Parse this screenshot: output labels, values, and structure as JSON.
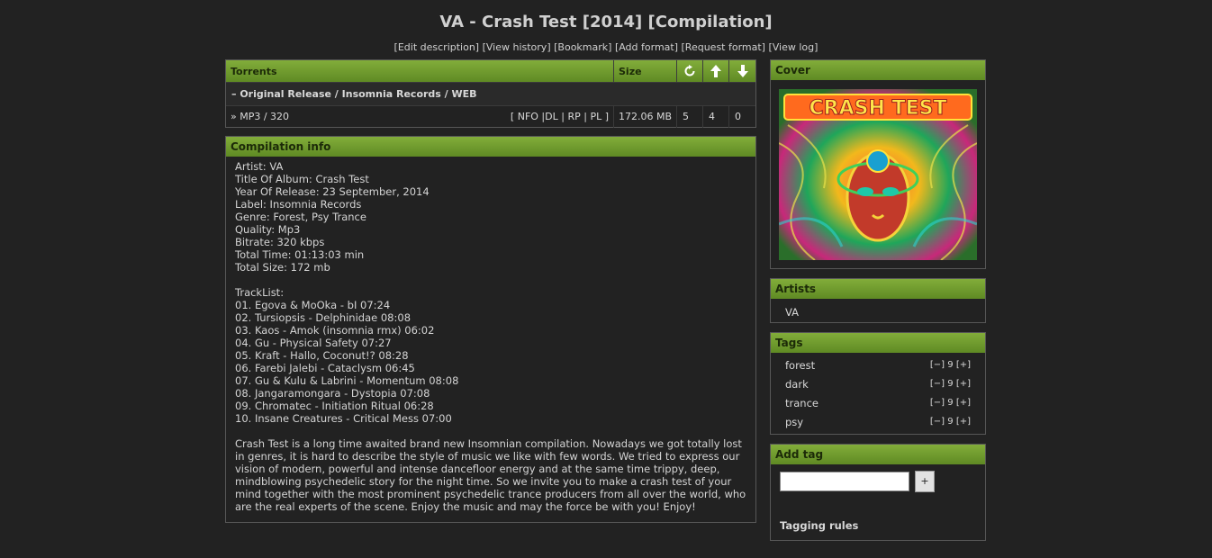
{
  "page": {
    "title": "VA - Crash Test [2014] [Compilation]"
  },
  "linkbox": {
    "edit_description": "[Edit description]",
    "view_history": "[View history]",
    "bookmark": "[Bookmark]",
    "add_format": "[Add format]",
    "request_format": "[Request format]",
    "view_log": "[View log]"
  },
  "torrents": {
    "header_torrents": "Torrents",
    "header_size": "Size",
    "snatches_icon": "refresh-icon",
    "seeders_icon": "arrow-up-icon",
    "leechers_icon": "arrow-down-icon",
    "group_label": "– Original Release / Insomnia Records / WEB",
    "format": {
      "name": "» MP3 / 320",
      "actions_open": "[",
      "nfo": "NFO",
      "dl": "DL",
      "rp": "RP",
      "pl": "PL",
      "actions_close": "]",
      "size": "172.06 MB",
      "snatches": "5",
      "seeders": "4",
      "leechers": "0"
    }
  },
  "info": {
    "title": "Compilation info",
    "details": [
      "Artist: VA",
      "Title Of Album: Crash Test",
      "Year Of Release: 23 September, 2014",
      "Label: Insomnia Records",
      "Genre: Forest, Psy Trance",
      "Quality: Mp3",
      "Bitrate: 320 kbps",
      "Total Time: 01:13:03 min",
      "Total Size: 172 mb"
    ],
    "tracklist_title": "TrackList:",
    "tracks": [
      "01. Egova & MoOka - bI 07:24",
      "02. Tursiopsis - Delphinidae 08:08",
      "03. Kaos - Amok (insomnia rmx) 06:02",
      "04. Gu - Physical Safety 07:27",
      "05. Kraft - Hallo, Coconut!? 08:28",
      "06. Farebi Jalebi - Cataclysm 06:45",
      "07. Gu & Kulu & Labrini - Momentum 08:08",
      "08. Jangaramongara - Dystopia 07:08",
      "09. Chromatec - Initiation Ritual 06:28",
      "10. Insane Creatures - Critical Mess 07:00"
    ],
    "description": [
      "Crash Test is a long time awaited brand new Insomnian compilation. Nowadays we got totally lost",
      "in genres, it is hard to describe the style of music we like with few words. We tried to express our",
      "vision of modern, powerful and intense dancefloor energy and at the same time trippy, deep,",
      "mindblowing psychedelic story for the night time. So we invite you to make a crash test of your",
      "mind together with the most prominent psychedelic trance producers from all over the world, who",
      "are the real experts of the scene. Enjoy the music and may the force be with you! Enjoy!"
    ]
  },
  "sidebar": {
    "cover_title": "Cover",
    "cover_text": "CRASH TEST",
    "artists_title": "Artists",
    "artist": "VA",
    "tags_title": "Tags",
    "tags": [
      {
        "name": "forest",
        "down": "[−]",
        "count": "9",
        "up": "[+]"
      },
      {
        "name": "dark",
        "down": "[−]",
        "count": "9",
        "up": "[+]"
      },
      {
        "name": "trance",
        "down": "[−]",
        "count": "9",
        "up": "[+]"
      },
      {
        "name": "psy",
        "down": "[−]",
        "count": "9",
        "up": "[+]"
      }
    ],
    "addtag_title": "Add tag",
    "add_button": "+",
    "tagging_rules": "Tagging rules"
  },
  "colors": {
    "background": "#222222",
    "header_green": "#6e9b2f",
    "border": "#575757"
  }
}
